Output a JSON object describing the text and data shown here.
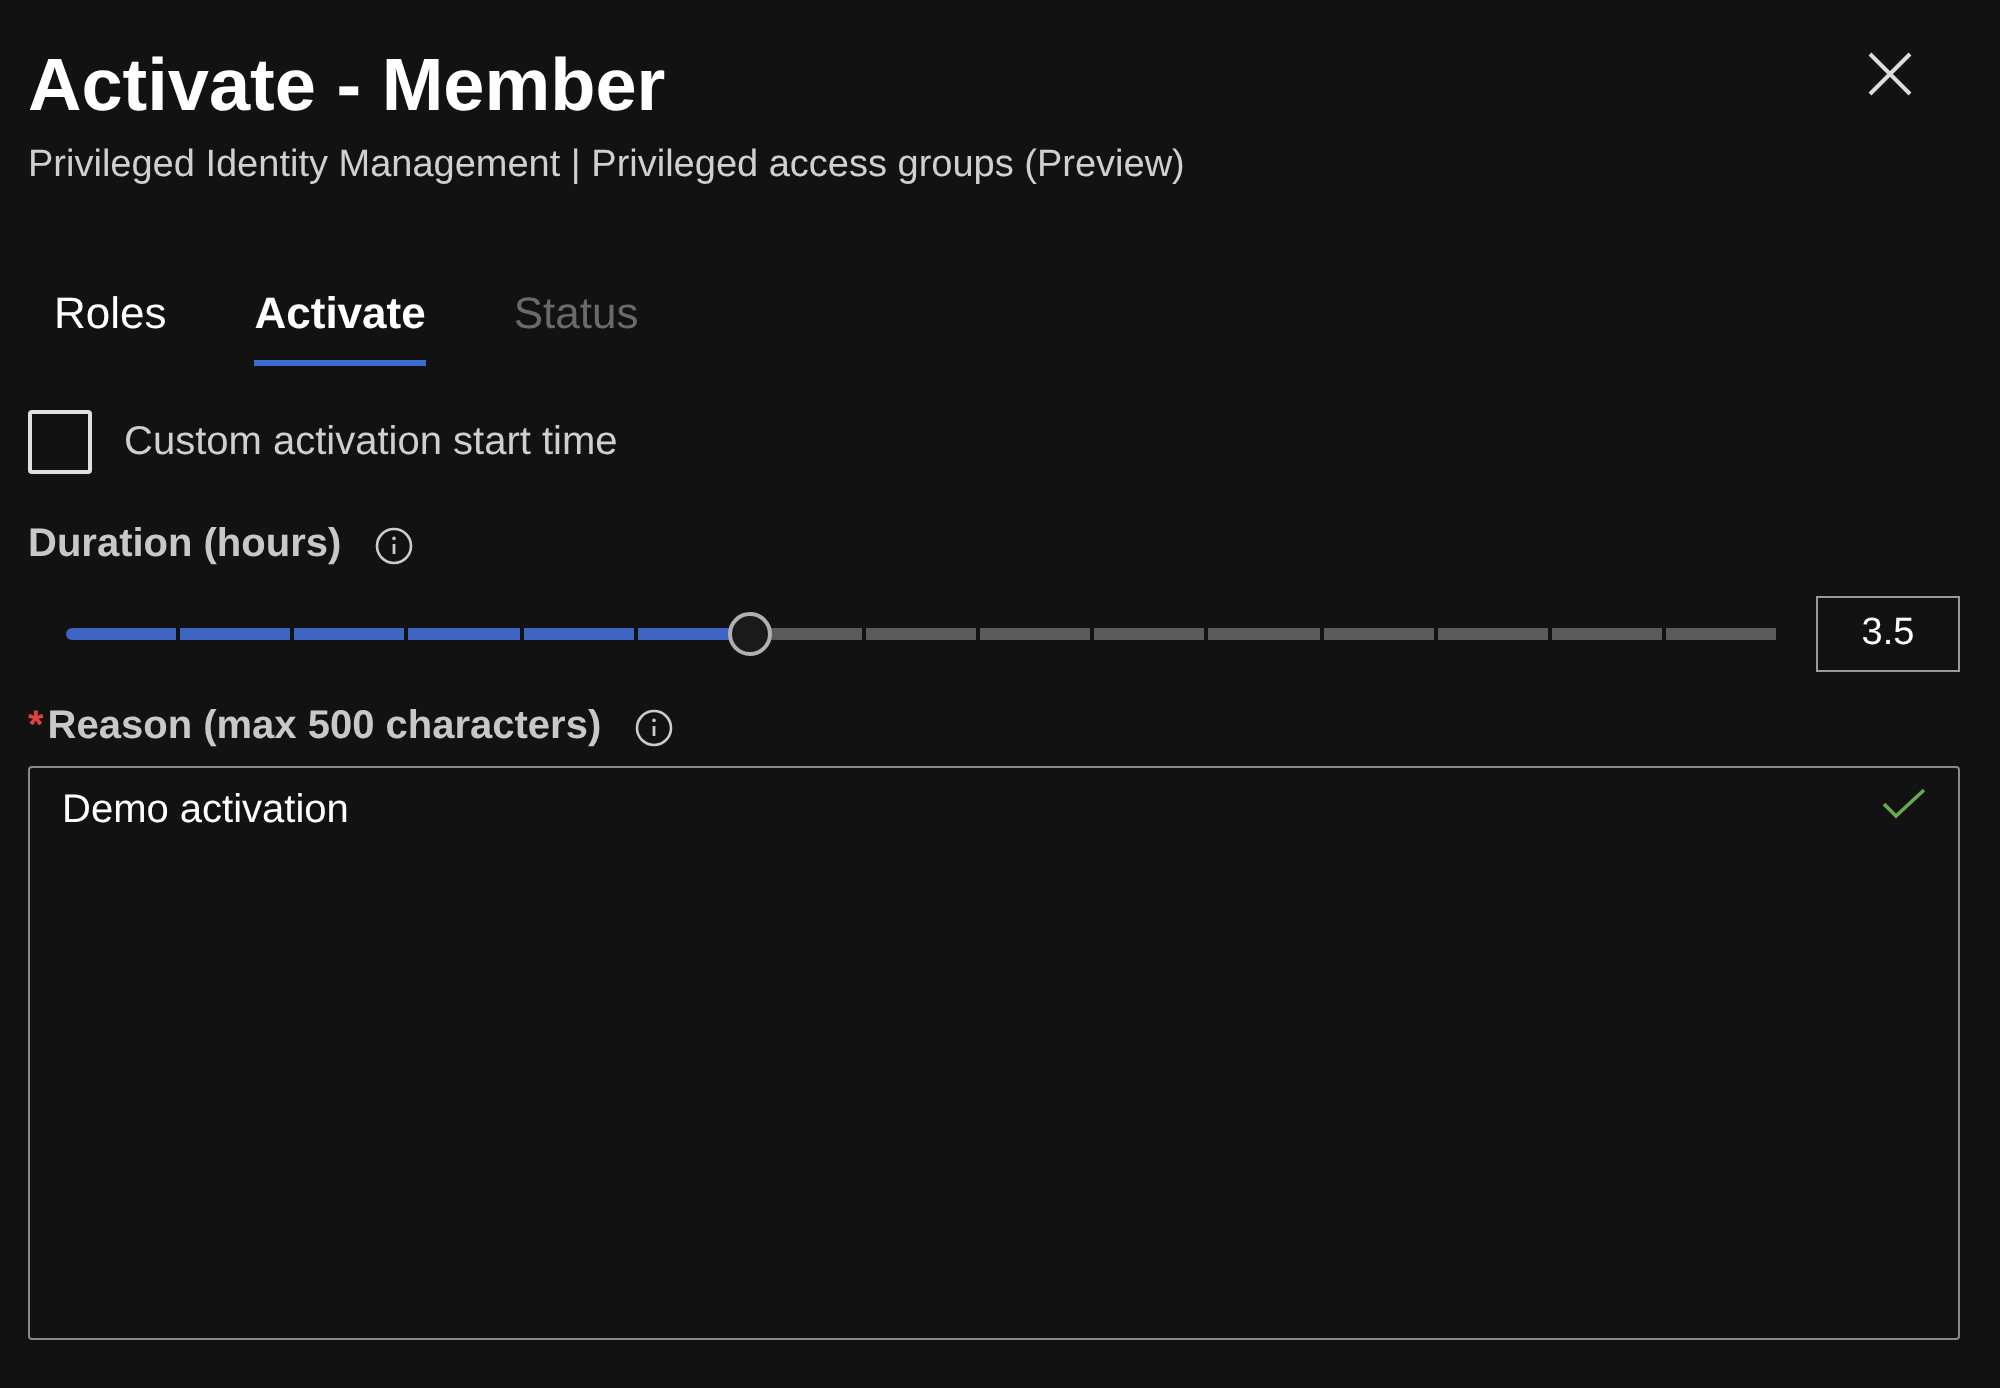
{
  "panel": {
    "title": "Activate - Member",
    "subtitle": "Privileged Identity Management | Privileged access groups (Preview)"
  },
  "tabs": [
    {
      "label": "Roles",
      "selected": false,
      "disabled": false
    },
    {
      "label": "Activate",
      "selected": true,
      "disabled": false
    },
    {
      "label": "Status",
      "selected": false,
      "disabled": true
    }
  ],
  "custom_start": {
    "label": "Custom activation start time",
    "checked": false
  },
  "duration": {
    "label": "Duration (hours)",
    "level": 0.4,
    "value": "3.5"
  },
  "reason": {
    "required_mark": "*",
    "label": "Reason (max 500 characters)",
    "value": "Demo activation",
    "valid": true
  }
}
